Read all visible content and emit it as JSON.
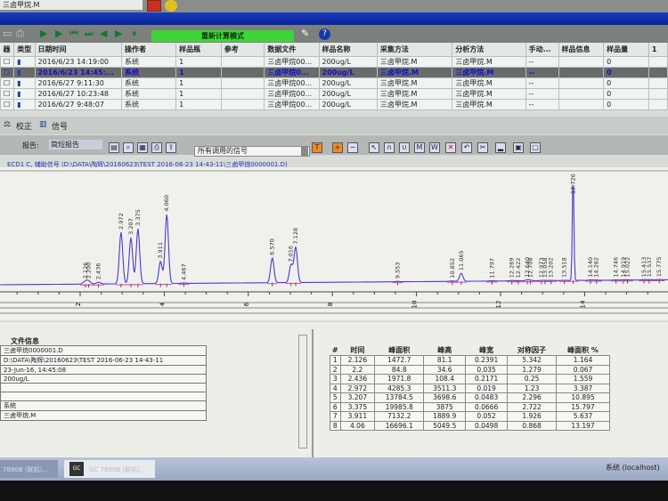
{
  "top": {
    "method_field": "三卤甲烷.M"
  },
  "toolbar": {
    "mode": "重新计算模式",
    "help": "?"
  },
  "sequence": {
    "columns": [
      "器",
      "类型",
      "日期时间",
      "操作者",
      "样品瓶",
      "参考",
      "数据文件",
      "样品名称",
      "采集方法",
      "分析方法",
      "手动...",
      "样品信息",
      "样品量",
      "1"
    ],
    "rows": [
      {
        "datetime": "2016/6/23 14:19:00",
        "operator": "系统",
        "vial": "1",
        "ref": "",
        "file": "三卤甲烷00...",
        "sample": "200ug/L",
        "acq": "三卤甲烷.M",
        "ana": "三卤甲烷.M",
        "manual": "--",
        "info": "",
        "amount": "0"
      },
      {
        "datetime": "2016/6/23 14:45:...",
        "operator": "系统",
        "vial": "1",
        "ref": "",
        "file": "三卤甲烷0...",
        "sample": "200ug/L",
        "acq": "三卤甲烷.M",
        "ana": "三卤甲烷.M",
        "manual": "--",
        "info": "",
        "amount": "0"
      },
      {
        "datetime": "2016/6/27 9:11:30",
        "operator": "系统",
        "vial": "1",
        "ref": "",
        "file": "三卤甲烷00...",
        "sample": "200ug/L",
        "acq": "三卤甲烷.M",
        "ana": "三卤甲烷.M",
        "manual": "--",
        "info": "",
        "amount": "0"
      },
      {
        "datetime": "2016/6/27 10:23:48",
        "operator": "系统",
        "vial": "1",
        "ref": "",
        "file": "三卤甲烷00...",
        "sample": "200ug/L",
        "acq": "三卤甲烷.M",
        "ana": "三卤甲烷.M",
        "manual": "--",
        "info": "",
        "amount": "0"
      },
      {
        "datetime": "2016/6/27 9:48:07",
        "operator": "系统",
        "vial": "1",
        "ref": "",
        "file": "三卤甲烷00...",
        "sample": "200ug/L",
        "acq": "三卤甲烷.M",
        "ana": "三卤甲烷.M",
        "manual": "--",
        "info": "",
        "amount": "0"
      }
    ]
  },
  "tabs": {
    "calibration": "校正",
    "signal": "信号"
  },
  "report": {
    "label": "报告:",
    "value": "简短报告",
    "signal_select": "所有调用的信号"
  },
  "signal_title": "ECD1 C, 辅助信号 (D:\\DATA\\陶辉\\20160623\\TEST 2016-06-23 14-43-11\\三卤甲烷0000001.D)",
  "chart_data": {
    "type": "line",
    "xlabel": "min",
    "xticks": [
      2,
      4,
      6,
      8,
      10,
      12,
      14
    ],
    "xlim": [
      0,
      16
    ],
    "peaks": [
      {
        "rt": 2.126,
        "h": 3,
        "label": "2.126"
      },
      {
        "rt": 2.2,
        "h": 3,
        "label": "2.200"
      },
      {
        "rt": 2.436,
        "h": 2,
        "label": "2.436"
      },
      {
        "rt": 2.972,
        "h": 58,
        "label": "2.972"
      },
      {
        "rt": 3.207,
        "h": 52,
        "label": "3.207"
      },
      {
        "rt": 3.375,
        "h": 62,
        "label": "3.375"
      },
      {
        "rt": 3.911,
        "h": 25,
        "label": "3.911"
      },
      {
        "rt": 4.06,
        "h": 78,
        "label": "4.060"
      },
      {
        "rt": 4.467,
        "h": 0.5,
        "label": "4.467"
      },
      {
        "rt": 6.57,
        "h": 28,
        "label": "6.570"
      },
      {
        "rt": 7.016,
        "h": 20,
        "label": "7.016"
      },
      {
        "rt": 7.128,
        "h": 40,
        "label": "7.128"
      },
      {
        "rt": 9.553,
        "h": 0.5,
        "label": "9.553"
      },
      {
        "rt": 10.852,
        "h": 0.5,
        "label": "10.852"
      },
      {
        "rt": 11.065,
        "h": 9,
        "label": "11.065"
      },
      {
        "rt": 11.797,
        "h": 0.3,
        "label": "11.797"
      },
      {
        "rt": 12.269,
        "h": 0.5,
        "label": "12.269"
      },
      {
        "rt": 12.422,
        "h": 0.3,
        "label": "12.422"
      },
      {
        "rt": 12.64,
        "h": 1,
        "label": "12.640"
      },
      {
        "rt": 12.708,
        "h": 0.5,
        "label": "12.708"
      },
      {
        "rt": 12.973,
        "h": 0.3,
        "label": "12.973"
      },
      {
        "rt": 13.058,
        "h": 0.3,
        "label": "13.058"
      },
      {
        "rt": 13.202,
        "h": 0.3,
        "label": "13.202"
      },
      {
        "rt": 13.518,
        "h": 0.3,
        "label": "13.518"
      },
      {
        "rt": 13.726,
        "h": 125,
        "label": "13.726"
      },
      {
        "rt": 14.14,
        "h": 0.5,
        "label": "14.140"
      },
      {
        "rt": 14.282,
        "h": 0.3,
        "label": "14.282"
      },
      {
        "rt": 14.746,
        "h": 0.3,
        "label": "14.746"
      },
      {
        "rt": 14.919,
        "h": 0.3,
        "label": "14.919"
      },
      {
        "rt": 15.022,
        "h": 0.3,
        "label": "15.022"
      },
      {
        "rt": 15.413,
        "h": 0.3,
        "label": "15.413"
      },
      {
        "rt": 15.537,
        "h": 0.3,
        "label": "15.537"
      },
      {
        "rt": 15.775,
        "h": 0.3,
        "label": "15.775"
      }
    ]
  },
  "file_info": {
    "title": "文件信息",
    "rows": [
      "三卤甲烷0000001.D",
      "D:\\DATA\\陶辉\\20160623\\TEST 2016-06-23 14-43-11",
      "23-Jun-16, 14:45:08",
      "200ug/L",
      "",
      "",
      "系统",
      "三卤甲烷.M"
    ]
  },
  "peak_table": {
    "columns": [
      "#",
      "时间",
      "峰面积",
      "峰高",
      "峰宽",
      "对称因子",
      "峰面积 %"
    ],
    "rows": [
      [
        "1",
        "2.126",
        "1472.7",
        "81.1",
        "0.2391",
        "5.342",
        "1.164"
      ],
      [
        "2",
        "2.2",
        "84.8",
        "34.6",
        "0.035",
        "1.279",
        "0.067"
      ],
      [
        "3",
        "2.436",
        "1971.8",
        "108.4",
        "0.2171",
        "0.25",
        "1.559"
      ],
      [
        "4",
        "2.972",
        "4285.3",
        "3511.3",
        "0.019",
        "1.23",
        "3.387"
      ],
      [
        "5",
        "3.207",
        "13784.5",
        "3698.6",
        "0.0483",
        "2.296",
        "10.895"
      ],
      [
        "6",
        "3.375",
        "19985.8",
        "3875",
        "0.0666",
        "2.722",
        "15.797"
      ],
      [
        "7",
        "3.911",
        "7132.2",
        "1889.9",
        "0.052",
        "1.926",
        "5.637"
      ],
      [
        "8",
        "4.06",
        "16696.1",
        "5049.5",
        "0.0498",
        "0.868",
        "13.197"
      ]
    ]
  },
  "taskbar": {
    "item1": "7890B (联机)...",
    "item2": "GC 7890B (联机)...",
    "user": "系统 (localhost)"
  }
}
